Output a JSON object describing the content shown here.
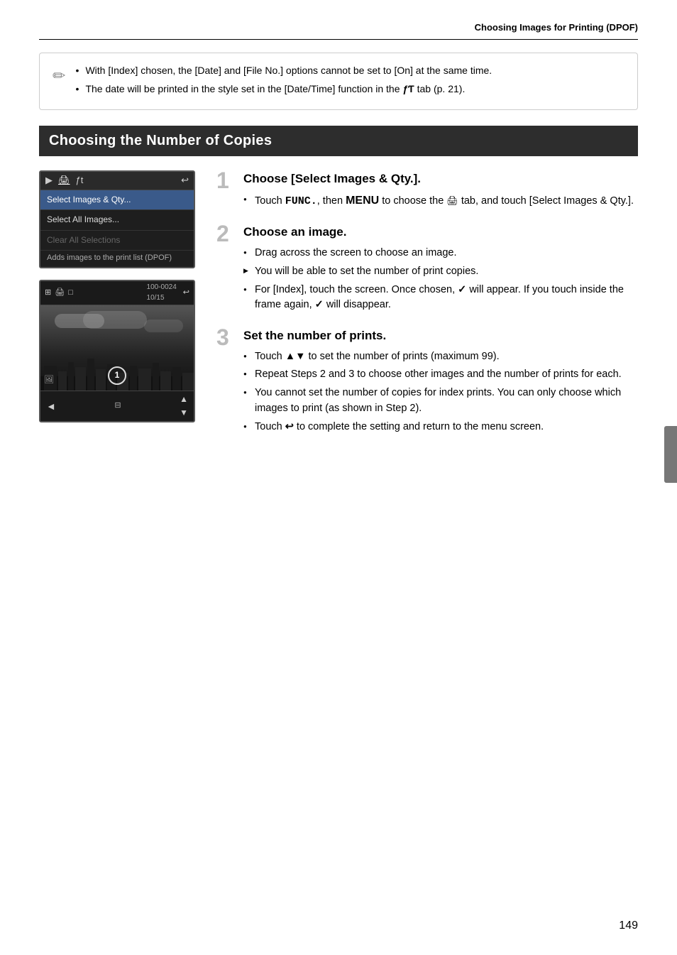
{
  "header": {
    "title": "Choosing Images for Printing (DPOF)"
  },
  "note": {
    "bullet1": "With [Index] chosen, the [Date] and [File No.] options cannot be set to [On] at the same time.",
    "bullet2": "The date will be printed in the style set in the [Date/Time] function in the",
    "bullet2_suffix": " tab (p. 21)."
  },
  "section_heading": "Choosing the Number of Copies",
  "camera_menu": {
    "icons": [
      "▶",
      "🖨",
      "𝒇𝒕"
    ],
    "back_icon": "↩",
    "items": [
      {
        "label": "Select Images & Qty...",
        "state": "selected"
      },
      {
        "label": "Select All Images...",
        "state": "normal"
      },
      {
        "label": "Clear All Selections",
        "state": "disabled"
      },
      {
        "label": "Adds images to the print list (DPOF)",
        "state": "desc"
      }
    ]
  },
  "camera_image": {
    "topbar_icon1": "⊞",
    "topbar_icon2": "🖨",
    "topbar_icon3": "□",
    "counter_label": "100-0024",
    "counter_page": "10/15",
    "back_icon": "↩",
    "footer_left": "◄",
    "footer_right": "▲",
    "footer_down": "▼",
    "circle_num": "1"
  },
  "steps": [
    {
      "number": "1",
      "title": "Choose [Select Images & Qty.].",
      "bullets": [
        {
          "type": "circle",
          "text": "Touch FUNC., then MENU to choose the  tab, and touch [Select Images & Qty.]."
        }
      ]
    },
    {
      "number": "2",
      "title": "Choose an image.",
      "bullets": [
        {
          "type": "circle",
          "text": "Drag across the screen to choose an image."
        },
        {
          "type": "triangle",
          "text": "You will be able to set the number of print copies."
        },
        {
          "type": "circle",
          "text": "For [Index], touch the screen. Once chosen, ✓ will appear. If you touch inside the frame again, ✓ will disappear."
        }
      ]
    },
    {
      "number": "3",
      "title": "Set the number of prints.",
      "bullets": [
        {
          "type": "circle",
          "text": "Touch ▲▼ to set the number of prints (maximum 99)."
        },
        {
          "type": "circle",
          "text": "Repeat Steps 2 and 3 to choose other images and the number of prints for each."
        },
        {
          "type": "circle",
          "text": "You cannot set the number of copies for index prints. You can only choose which images to print (as shown in Step 2)."
        },
        {
          "type": "circle",
          "text": "Touch  to complete the setting and return to the menu screen."
        }
      ]
    }
  ],
  "page_number": "149"
}
